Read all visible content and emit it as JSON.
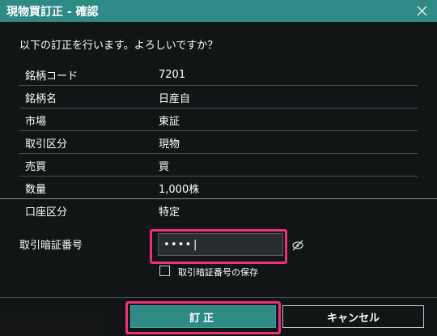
{
  "dialog": {
    "title": "現物買訂正 - 確認",
    "question": "以下の訂正を行います。よろしいですか？",
    "rows": [
      {
        "label": "銘柄コード",
        "value": "7201"
      },
      {
        "label": "銘柄名",
        "value": "日産自"
      },
      {
        "label": "市場",
        "value": "東証"
      },
      {
        "label": "取引区分",
        "value": "現物"
      },
      {
        "label": "売買",
        "value": "買"
      },
      {
        "label": "数量",
        "value": "1,000株"
      },
      {
        "label": "口座区分",
        "value": "特定"
      }
    ],
    "pin": {
      "label": "取引暗証番号",
      "value": "••••|",
      "placeholder": ""
    },
    "save_pin_label": "取引暗証番号の保存",
    "confirm_label": "訂正",
    "cancel_label": "キャンセル"
  },
  "colors": {
    "title_bar": "#2f8a86",
    "highlight": "#ee2f7c",
    "confirm_button": "#2f8a86"
  }
}
